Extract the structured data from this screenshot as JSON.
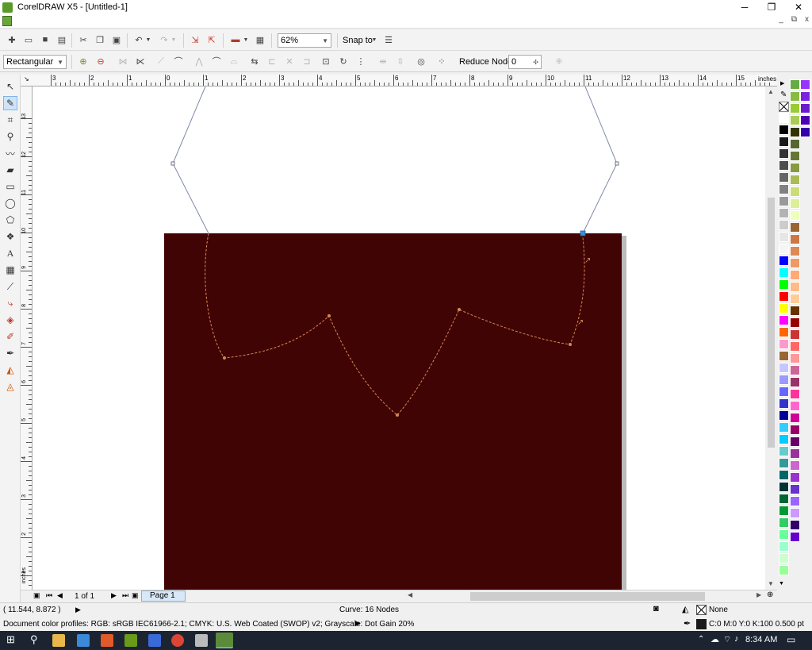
{
  "window": {
    "title": "CorelDRAW X5 - [Untitled-1]",
    "minimize": "─",
    "restore": "❐",
    "close": "✕"
  },
  "menubar": {
    "mdi_min": "_",
    "mdi_restore": "⧉",
    "mdi_close": "x"
  },
  "toolbar": {
    "zoom_value": "62%",
    "snap_label": "Snap to"
  },
  "property_bar": {
    "shape_mode": "Rectangular",
    "reduce_nodes_label": "Reduce Nodes",
    "reduce_nodes_value": "0"
  },
  "rulers": {
    "units": "inches",
    "h_ticks": [
      "3",
      "2",
      "1",
      "0",
      "1",
      "2",
      "3",
      "4",
      "5",
      "6",
      "7",
      "8",
      "9",
      "10",
      "11",
      "12",
      "13",
      "14",
      "15"
    ],
    "v_ticks": [
      "13",
      "12",
      "11",
      "10",
      "9",
      "8",
      "7",
      "6",
      "5",
      "4",
      "3",
      "2",
      "1"
    ]
  },
  "document": {
    "page_fill_color": "#410404",
    "curve_color": "#7d8aa8",
    "dashed_curve_color": "#d48a55"
  },
  "page_nav": {
    "page_count_text": "1 of 1",
    "page_tab": "Page 1"
  },
  "status": {
    "cursor_coords": "( 11.544, 8.872 )",
    "object_info": "Curve: 16 Nodes",
    "color_profiles": "Document color profiles: RGB: sRGB IEC61966-2.1; CMYK: U.S. Web Coated (SWOP) v2; Grayscale: Dot Gain 20%",
    "fill_label": "None",
    "outline_label": "C:0 M:0 Y:0 K:100  0.500 pt"
  },
  "taskbar": {
    "time": "8:34 AM"
  },
  "palette_colors": {
    "col1": [
      "#ffffff",
      "#000000",
      "#1a1a1a",
      "#333333",
      "#4d4d4d",
      "#666666",
      "#808080",
      "#999999",
      "#b3b3b3",
      "#cccccc",
      "#e6e6e6",
      "#f5f5f5",
      "#0000ff",
      "#00ffff",
      "#00ff00",
      "#ff0000",
      "#ffff00",
      "#ff00ff",
      "#ff6600",
      "#ff99cc",
      "#996633",
      "#c6c6ff",
      "#9999ff",
      "#6666ff",
      "#3333cc",
      "#000099",
      "#33ccff",
      "#00ccff",
      "#66cccc",
      "#339999",
      "#006666",
      "#003333",
      "#006633",
      "#009933",
      "#33cc66",
      "#66ff99",
      "#99ffcc",
      "#ccffcc",
      "#99ff99"
    ],
    "col2": [
      "#66aa44",
      "#88bb44",
      "#99cc33",
      "#aacc55",
      "#333300",
      "#556633",
      "#667733",
      "#889944",
      "#aabb55",
      "#ccdd77",
      "#ddee99",
      "#eeffbb",
      "#996633",
      "#cc7744",
      "#dd8855",
      "#ee9966",
      "#ffaa77",
      "#ffbb88",
      "#ffcc99",
      "#663300",
      "#990000",
      "#cc3333",
      "#ff6666",
      "#ff9999",
      "#cc6699",
      "#993366",
      "#ff3399",
      "#ff66cc",
      "#cc0099",
      "#990066",
      "#660066",
      "#993399",
      "#cc66cc",
      "#9933cc",
      "#6633cc",
      "#9966ff",
      "#cc99ff",
      "#330066",
      "#6600cc"
    ],
    "col3": [
      "#9933ff",
      "#7a22dd",
      "#6a1acc",
      "#4d00b3",
      "#3300aa"
    ]
  }
}
